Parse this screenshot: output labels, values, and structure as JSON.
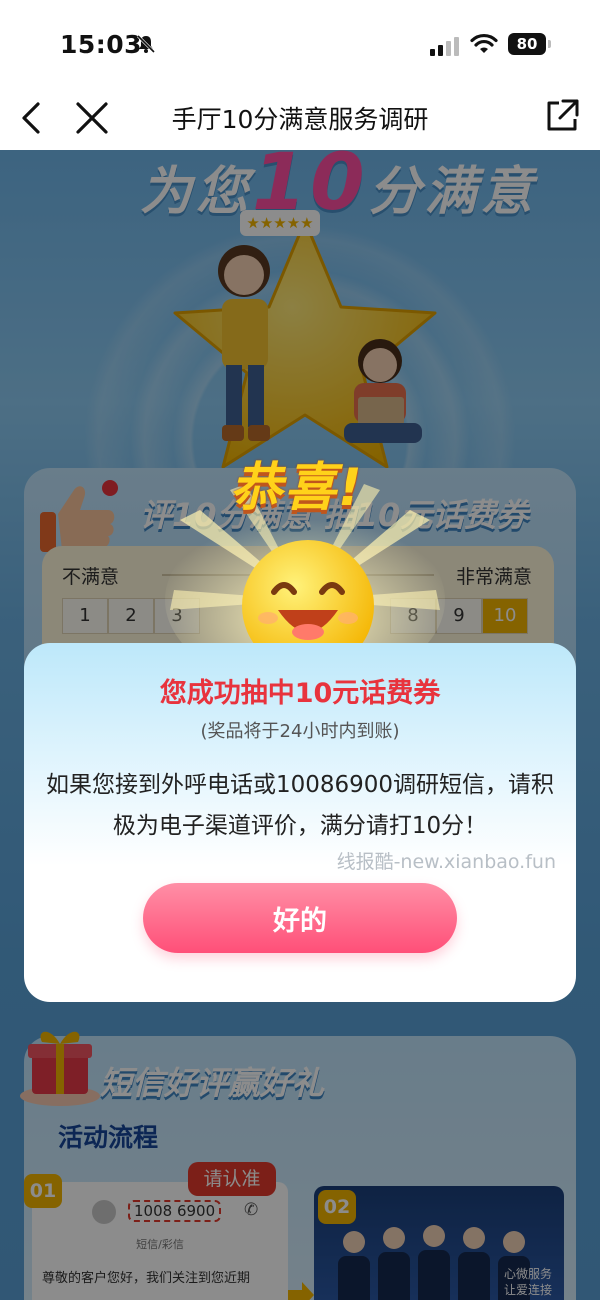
{
  "status_bar": {
    "time": "15:03",
    "battery": "80"
  },
  "nav": {
    "title": "手厅10分满意服务调研"
  },
  "hero": {
    "title_pre": "为您",
    "title_num": "10",
    "title_post": "分满意",
    "stars": "★★★★★"
  },
  "rating_card": {
    "heading": "评10分满意 抽10元话费券",
    "left_label": "不满意",
    "right_label": "非常满意",
    "scale_low": [
      "1",
      "2",
      "3"
    ],
    "scale_high": [
      "8",
      "9",
      "10"
    ]
  },
  "celebration": {
    "text": "恭喜!"
  },
  "dialog": {
    "title": "您成功抽中10元话费券",
    "subtitle": "(奖品将于24小时内到账)",
    "body": "如果您接到外呼电话或10086900调研短信，请积极为电子渠道评价，满分请打10分！",
    "watermark": "线报酷-new.xianbao.fun",
    "ok_button": "好的"
  },
  "sms_card": {
    "heading": "短信好评赢好礼",
    "flow_title": "活动流程",
    "notice": "请认准",
    "step1_num": "01",
    "step2_num": "02",
    "sms_number": "1008 6900",
    "sms_kind": "短信/彩信",
    "sms_body": "尊敬的客户您好，我们关注到您近期",
    "step2_text_1": "心微服务",
    "step2_text_2": "让爱连接"
  },
  "colors": {
    "accent_red": "#e8333d",
    "button_pink": "#ff4f78",
    "gold": "#f3b400",
    "sky": "#6fb6ea"
  }
}
